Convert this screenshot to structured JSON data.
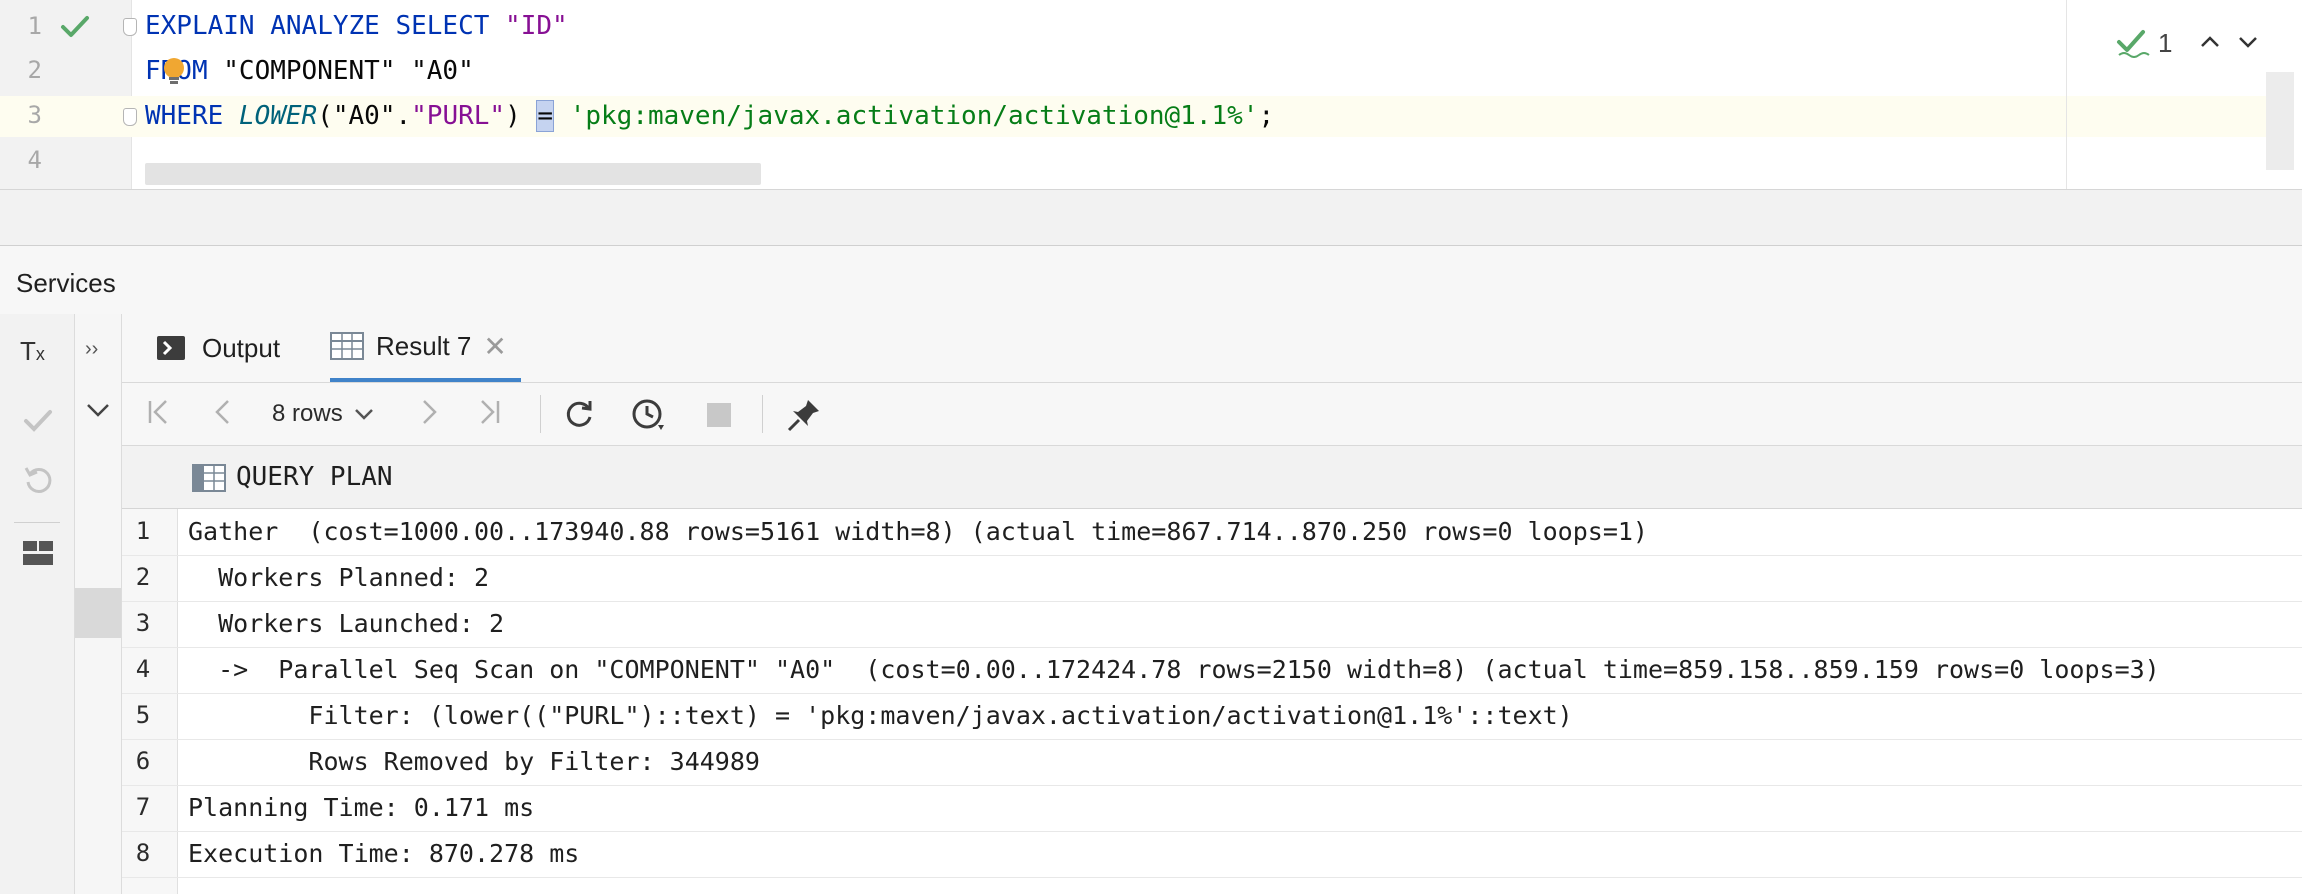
{
  "editor": {
    "line_numbers": [
      "1",
      "2",
      "3",
      "4"
    ],
    "code": {
      "line1": {
        "kw1": "EXPLAIN",
        "kw2": "ANALYZE",
        "kw3": "SELECT",
        "str1": "\"ID\""
      },
      "line2": {
        "kw1": "FROM",
        "str1": "\"COMPONENT\"",
        "str2": "\"A0\""
      },
      "line3": {
        "kw1": "WHERE",
        "fn": "LOWER",
        "p_open": "(",
        "str1": "\"A0\"",
        "dot": ".",
        "str2": "\"PURL\"",
        "p_close": ")",
        "op": "=",
        "literal": "'pkg:maven/javax.activation/activation@1.1%'",
        "semi": ";"
      }
    },
    "inspection_count": "1"
  },
  "services": {
    "title": "Services"
  },
  "tabs": [
    {
      "label": "Output"
    },
    {
      "label": "Result 7"
    }
  ],
  "result_toolbar": {
    "rows_label": "8 rows"
  },
  "grid": {
    "column_header": "QUERY PLAN",
    "rows": [
      {
        "num": "1",
        "text": "Gather  (cost=1000.00..173940.88 rows=5161 width=8) (actual time=867.714..870.250 rows=0 loops=1)"
      },
      {
        "num": "2",
        "text": "  Workers Planned: 2"
      },
      {
        "num": "3",
        "text": "  Workers Launched: 2"
      },
      {
        "num": "4",
        "text": "  ->  Parallel Seq Scan on \"COMPONENT\" \"A0\"  (cost=0.00..172424.78 rows=2150 width=8) (actual time=859.158..859.159 rows=0 loops=3)"
      },
      {
        "num": "5",
        "text": "        Filter: (lower((\"PURL\")::text) = 'pkg:maven/javax.activation/activation@1.1%'::text)"
      },
      {
        "num": "6",
        "text": "        Rows Removed by Filter: 344989"
      },
      {
        "num": "7",
        "text": "Planning Time: 0.171 ms"
      },
      {
        "num": "8",
        "text": "Execution Time: 870.278 ms"
      }
    ]
  },
  "icons": {
    "run_status": "check-icon",
    "intention": "lightbulb-icon",
    "inspection": "inspection-ok-icon",
    "tx": "transaction-mode-icon"
  },
  "colors": {
    "keyword": "#0033b3",
    "identifier_string": "#871094",
    "function": "#00627a",
    "literal": "#067d17",
    "tab_underline": "#4083c9",
    "check_green": "#59a869"
  }
}
